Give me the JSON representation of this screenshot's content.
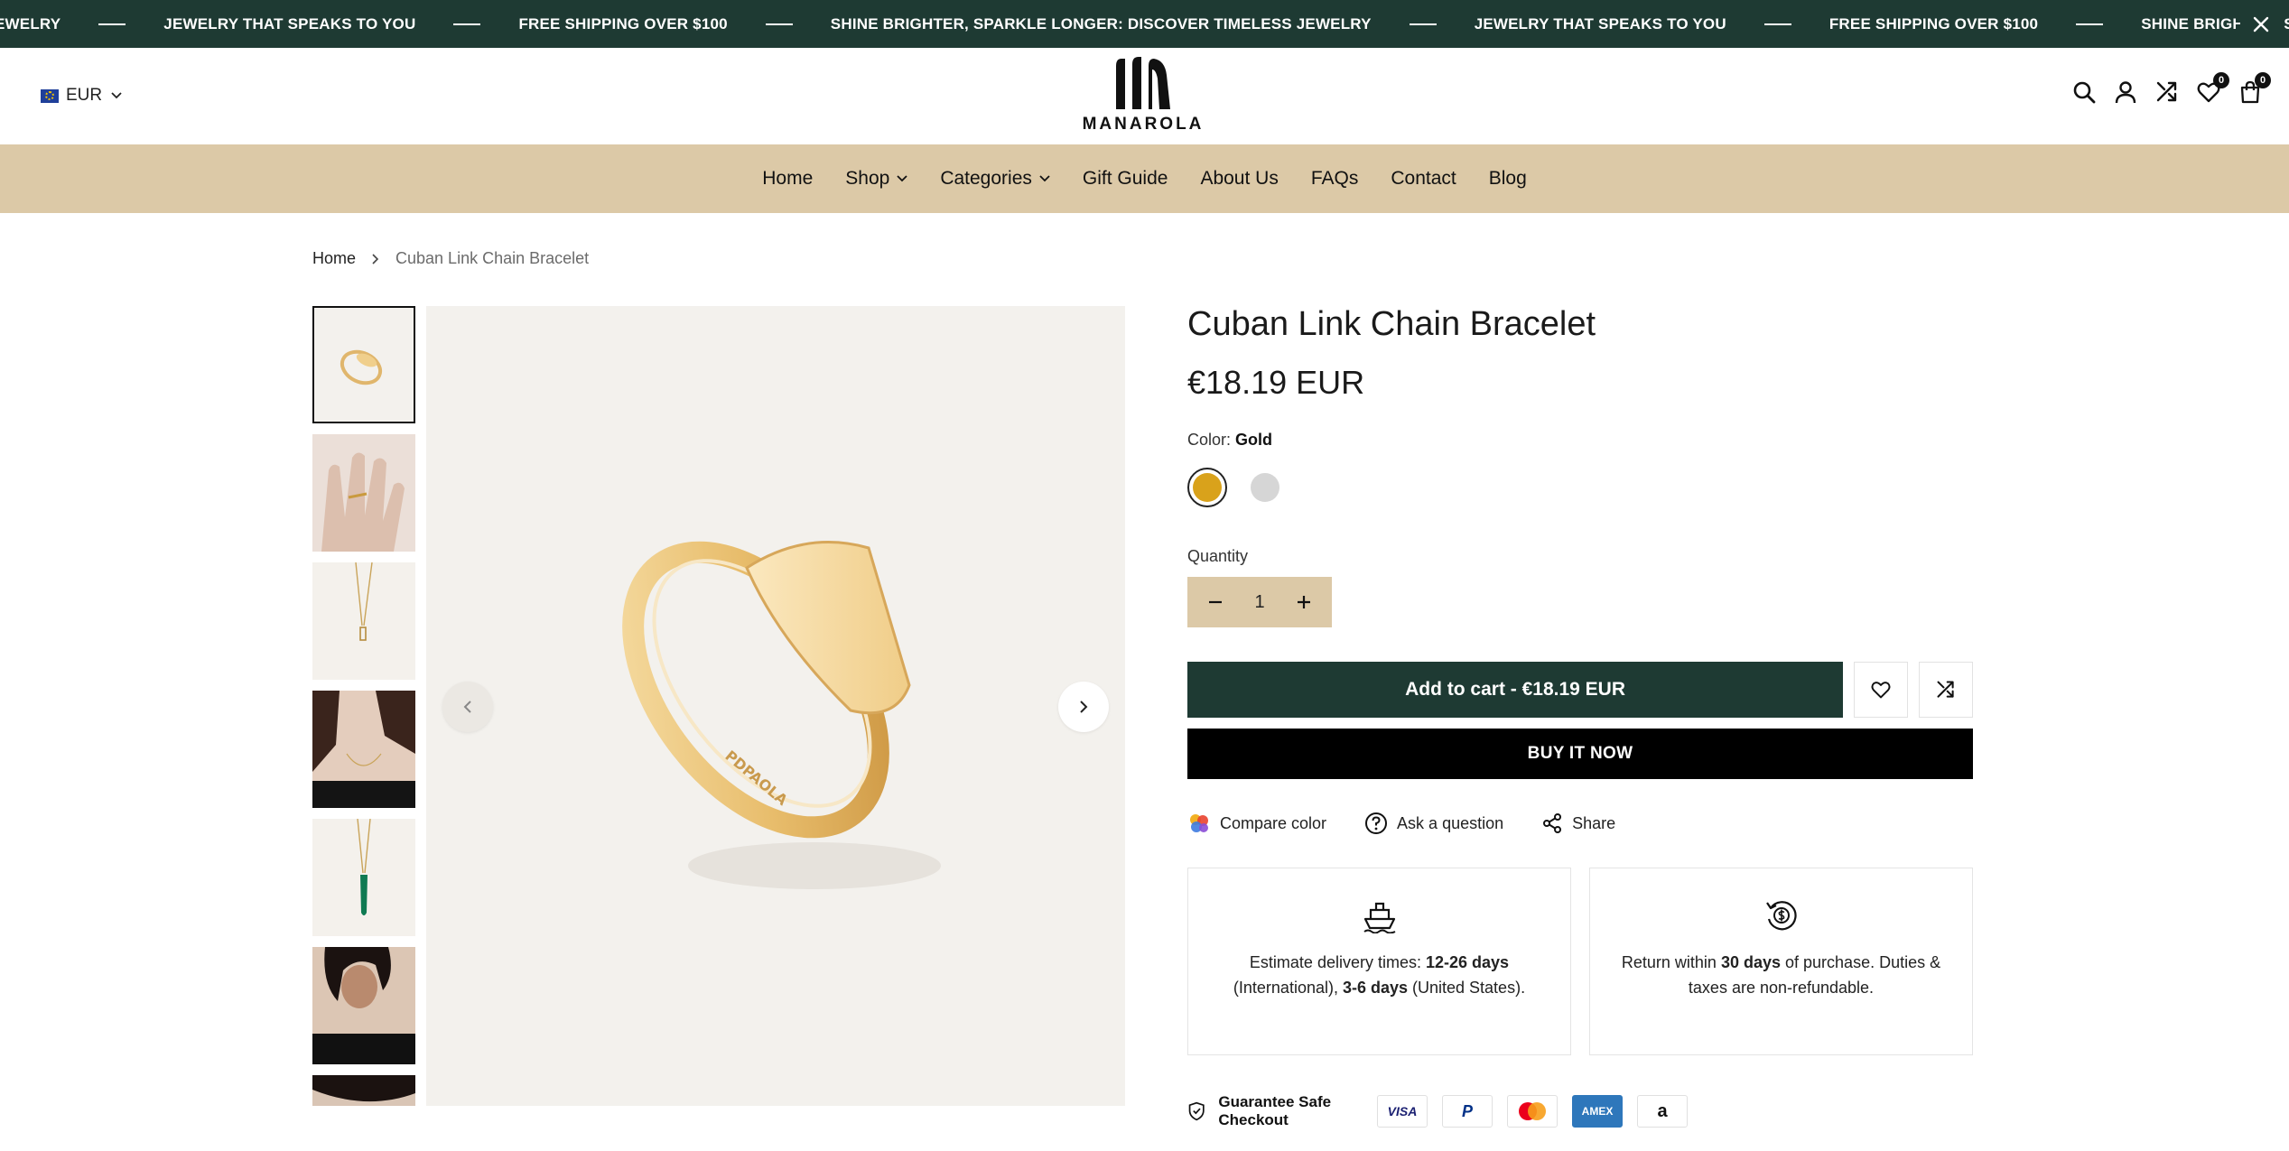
{
  "announcement": {
    "items": [
      "EWELRY",
      "JEWELRY THAT SPEAKS TO YOU",
      "FREE SHIPPING OVER $100",
      "SHINE BRIGHTER, SPARKLE LONGER: DISCOVER TIMELESS JEWELRY",
      "JEWELRY THAT SPEAKS TO YOU",
      "FREE SHIPPING OVER $100",
      "SHINE BRIGHTER, SPARKLE LONGER: DISCOVER TIMELESS JEWELRY"
    ]
  },
  "header": {
    "currency": "EUR",
    "brand": "MANAROLA",
    "wishlist_count": "0",
    "cart_count": "0"
  },
  "nav": {
    "items": [
      {
        "label": "Home",
        "dropdown": false
      },
      {
        "label": "Shop",
        "dropdown": true
      },
      {
        "label": "Categories",
        "dropdown": true
      },
      {
        "label": "Gift Guide",
        "dropdown": false
      },
      {
        "label": "About Us",
        "dropdown": false
      },
      {
        "label": "FAQs",
        "dropdown": false
      },
      {
        "label": "Contact",
        "dropdown": false
      },
      {
        "label": "Blog",
        "dropdown": false
      }
    ]
  },
  "breadcrumb": {
    "home": "Home",
    "current": "Cuban Link Chain Bracelet"
  },
  "product": {
    "title": "Cuban Link Chain Bracelet",
    "price": "€18.19 EUR",
    "color_label": "Color:",
    "color_value": "Gold",
    "swatches": [
      {
        "name": "Gold",
        "color": "#d9a21b"
      },
      {
        "name": "Silver",
        "color": "#d6d6d6"
      }
    ],
    "quantity_label": "Quantity",
    "quantity": "1",
    "add_to_cart": "Add to cart - €18.19 EUR",
    "buy_now": "BUY IT NOW",
    "image_engraving": "PDPAOLA"
  },
  "actions": {
    "compare_color": "Compare color",
    "ask_question": "Ask a question",
    "share": "Share"
  },
  "policies": {
    "delivery": {
      "pre": "Estimate delivery times: ",
      "intl_days": "12-26 days",
      "intl_suffix": " (International), ",
      "us_days": "3-6 days",
      "us_suffix": " (United States)."
    },
    "returns": {
      "pre": "Return within ",
      "days": "30 days",
      "suffix": " of purchase. Duties & taxes are non-refundable."
    }
  },
  "checkout": {
    "label": "Guarantee Safe Checkout",
    "methods": [
      "VISA",
      "P",
      "mastercard",
      "AMEX",
      "a"
    ]
  },
  "colors": {
    "announcement_bg": "#1e3a33",
    "nav_bg": "#dcc9a7",
    "primary_button": "#1e3a33",
    "buy_now": "#000000"
  }
}
